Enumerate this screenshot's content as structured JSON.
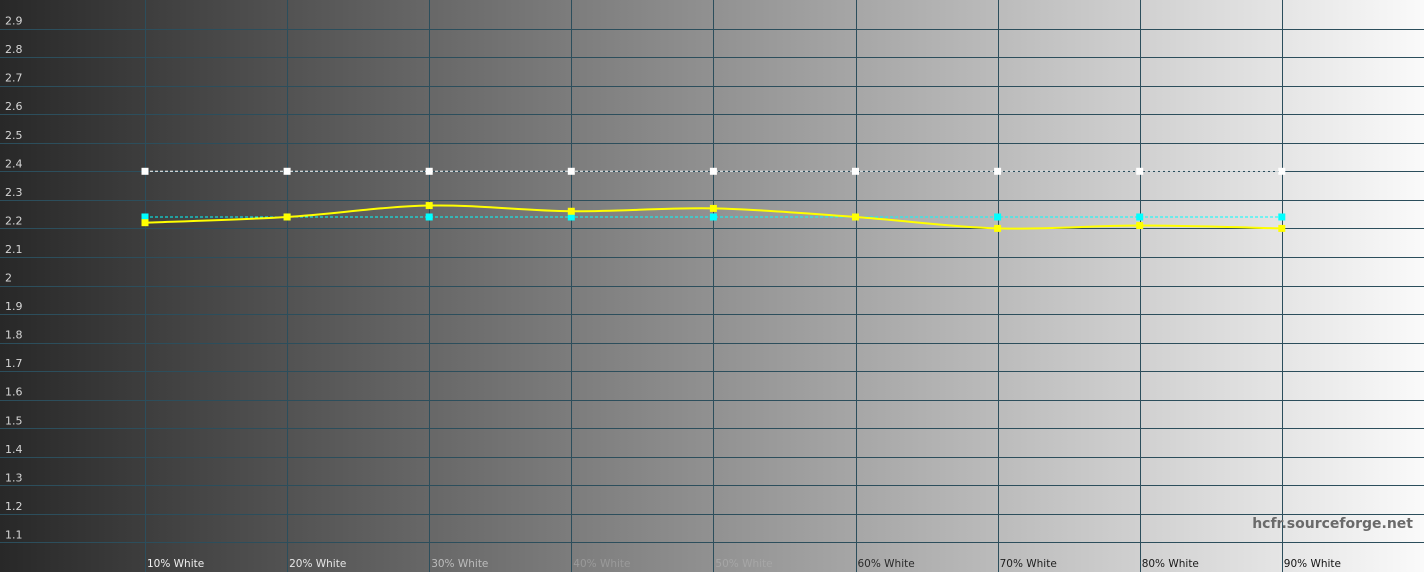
{
  "chart_data": {
    "type": "line",
    "title": "",
    "xlabel": "",
    "ylabel": "",
    "ylim": [
      1.0,
      3.0
    ],
    "y_ticks": [
      "1.1",
      "1.2",
      "1.3",
      "1.4",
      "1.5",
      "1.6",
      "1.7",
      "1.8",
      "1.9",
      "2",
      "2.1",
      "2.2",
      "2.3",
      "2.4",
      "2.5",
      "2.6",
      "2.7",
      "2.8",
      "2.9"
    ],
    "categories": [
      "10% White",
      "20% White",
      "30% White",
      "40% White",
      "50% White",
      "60% White",
      "70% White",
      "80% White",
      "90% White"
    ],
    "grid": true,
    "legend": "none",
    "series": [
      {
        "color": "#ffff00",
        "style": "solid",
        "marker": "square",
        "values": [
          2.22,
          2.24,
          2.28,
          2.26,
          2.27,
          2.24,
          2.2,
          2.21,
          2.2
        ]
      },
      {
        "color": "#00ffff",
        "style": "dashed",
        "marker": "square",
        "values": [
          2.24,
          2.24,
          2.24,
          2.24,
          2.24,
          2.24,
          2.24,
          2.24,
          2.24
        ]
      },
      {
        "color": "#ffffff",
        "style": "dashed",
        "marker": "square",
        "values": [
          2.4,
          2.4,
          2.4,
          2.4,
          2.4,
          2.4,
          2.4,
          2.4,
          2.4
        ]
      }
    ],
    "colors": {
      "gridline": "#2c4e5c",
      "background_dark": "#282828",
      "background_light": "#fafafa"
    }
  },
  "watermark": "hcfr.sourceforge.net"
}
